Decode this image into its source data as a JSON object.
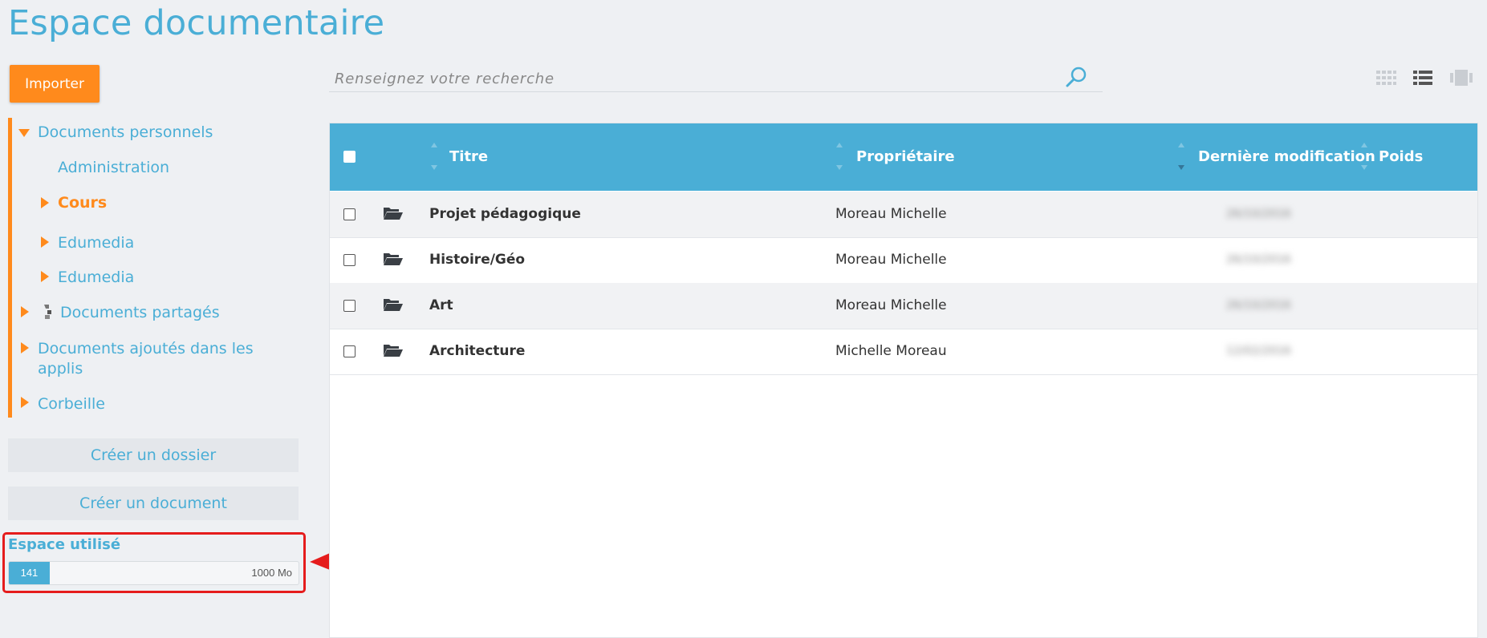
{
  "page": {
    "title": "Espace documentaire"
  },
  "sidebar": {
    "import_label": "Importer",
    "tree": {
      "personal": "Documents personnels",
      "administration": "Administration",
      "cours": "Cours",
      "edumedia_1": "Edumedia",
      "edumedia_2": "Edumedia",
      "shared": "Documents partagés",
      "apps_line1": "Documents ajoutés dans les",
      "apps_line2": "applis",
      "trash": "Corbeille"
    },
    "create_folder": "Créer un dossier",
    "create_document": "Créer un document",
    "quota": {
      "label": "Espace utilisé",
      "used": "141",
      "max": "1000 Mo",
      "fraction": 0.141
    }
  },
  "search": {
    "placeholder": "Renseignez votre recherche"
  },
  "table": {
    "headers": {
      "title": "Titre",
      "owner": "Propriétaire",
      "modified": "Dernière modification",
      "size": "Poids"
    },
    "rows": [
      {
        "title": "Projet pédagogique",
        "owner": "Moreau Michelle",
        "modified": "26/10/2016"
      },
      {
        "title": "Histoire/Géo",
        "owner": "Moreau Michelle",
        "modified": "26/10/2016"
      },
      {
        "title": "Art",
        "owner": "Moreau Michelle",
        "modified": "26/10/2016"
      },
      {
        "title": "Architecture",
        "owner": "Michelle Moreau",
        "modified": "12/02/2016"
      }
    ]
  },
  "icons": {
    "view_grid": "grid-view-icon",
    "view_list": "list-view-icon",
    "view_carousel": "carousel-view-icon",
    "search": "search-icon",
    "folder": "folder-open-icon"
  },
  "colors": {
    "accent": "#4aaed6",
    "orange": "#ff8a1c",
    "annotation": "#e51c1c"
  }
}
